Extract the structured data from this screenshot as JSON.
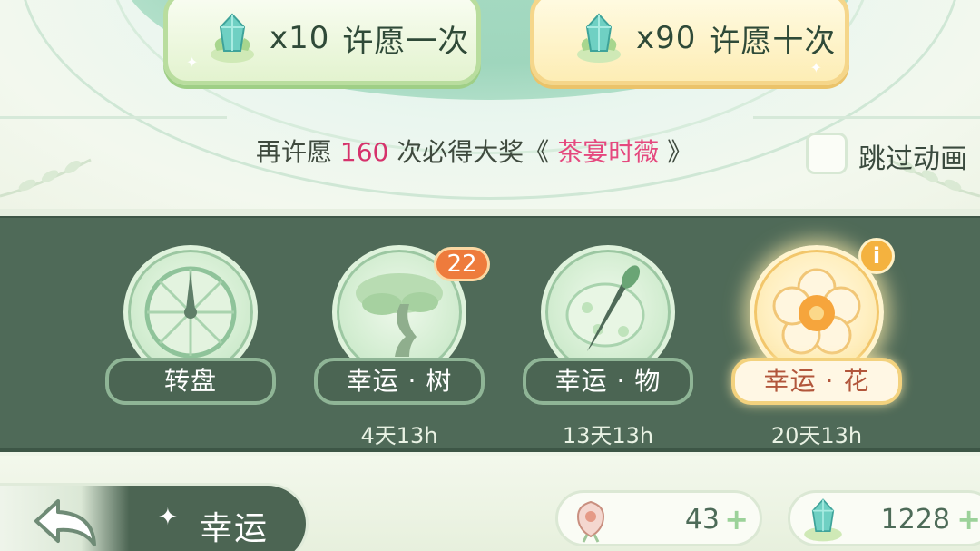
{
  "wish": {
    "single": {
      "cost": "x10",
      "label": "许愿一次"
    },
    "ten": {
      "cost": "x90",
      "label": "许愿十次"
    }
  },
  "pity": {
    "prefix": "再许愿",
    "count": "160",
    "middle": "次必得大奖《",
    "prize": "茶宴时薇",
    "suffix": "》"
  },
  "skip_animation": {
    "label": "跳过动画",
    "checked": false
  },
  "events": [
    {
      "label": "转盘",
      "timer": "",
      "icon": "wheel-icon",
      "active": false
    },
    {
      "label": "幸运 · 树",
      "timer": "4天13h",
      "icon": "tree-icon",
      "active": false,
      "badge": "22"
    },
    {
      "label": "幸运 · 物",
      "timer": "13天13h",
      "icon": "brush-palette-icon",
      "active": false
    },
    {
      "label": "幸运 · 花",
      "timer": "20天13h",
      "icon": "flower-icon",
      "active": true
    }
  ],
  "bottom": {
    "section_title": "幸运",
    "currencies": [
      {
        "icon": "flower-token-icon",
        "amount": "43"
      },
      {
        "icon": "green-gem-icon",
        "amount": "1228"
      }
    ]
  },
  "colors": {
    "band": "#4f6a58",
    "accent_pink": "#e5487e",
    "badge_orange": "#ee7b3c",
    "active_gold": "#f2c66b"
  }
}
